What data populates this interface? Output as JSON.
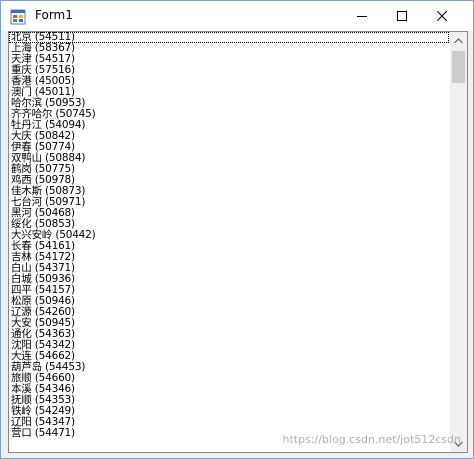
{
  "window": {
    "title": "Form1",
    "icon": "winforms-app-icon",
    "controls": {
      "minimize_icon": "minimize-icon",
      "maximize_icon": "maximize-icon",
      "close_icon": "close-icon"
    }
  },
  "listbox": {
    "selected_index": 0,
    "items": [
      "北京 (54511)",
      "上海 (58367)",
      "天津 (54517)",
      "重庆 (57516)",
      "香港 (45005)",
      "澳门 (45011)",
      "哈尔滨 (50953)",
      "齐齐哈尔 (50745)",
      "牡丹江 (54094)",
      "大庆 (50842)",
      "伊春 (50774)",
      "双鸭山 (50884)",
      "鹤岗 (50775)",
      "鸡西 (50978)",
      "佳木斯 (50873)",
      "七台河 (50971)",
      "黑河 (50468)",
      "绥化 (50853)",
      "大兴安岭 (50442)",
      "长春 (54161)",
      "吉林 (54172)",
      "白山 (54371)",
      "白城 (50936)",
      "四平 (54157)",
      "松原 (50946)",
      "辽源 (54260)",
      "大安 (50945)",
      "通化 (54363)",
      "沈阳 (54342)",
      "大连 (54662)",
      "葫芦岛 (54453)",
      "旅顺 (54660)",
      "本溪 (54346)",
      "抚顺 (54353)",
      "铁岭 (54249)",
      "辽阳 (54347)",
      "营口 (54471)"
    ]
  },
  "watermark": "https://blog.csdn.net/jot512csdn"
}
